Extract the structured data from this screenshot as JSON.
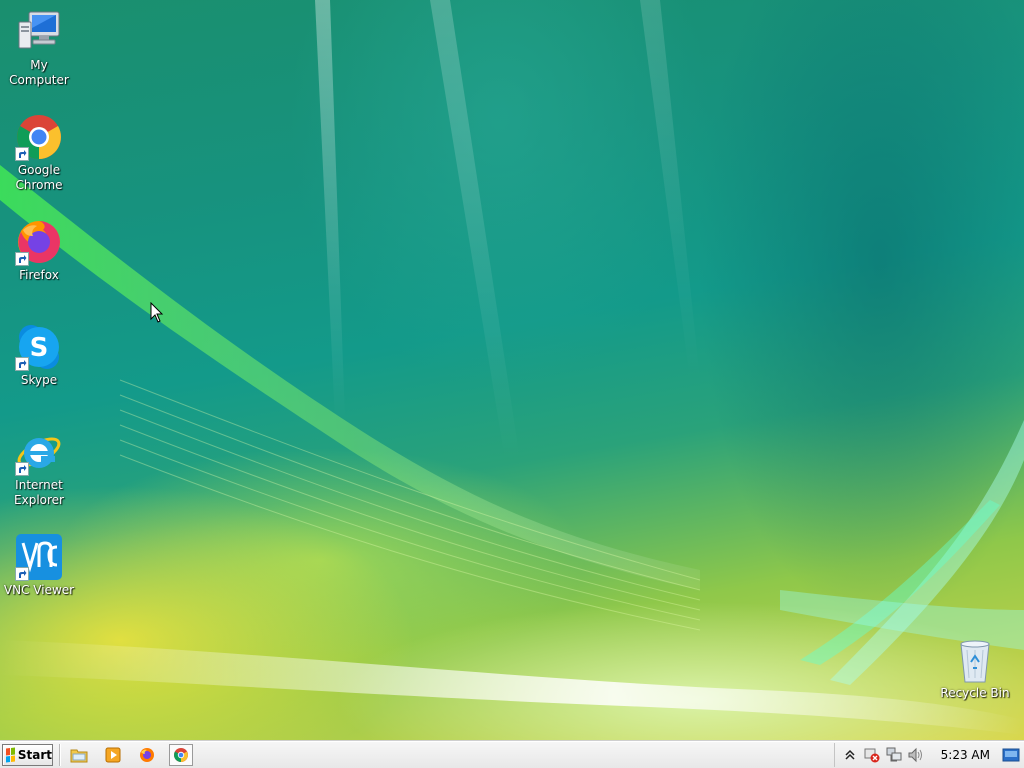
{
  "desktop": {
    "icons": [
      {
        "label": "My Computer",
        "icon": "computer-icon"
      },
      {
        "label": "Google Chrome",
        "icon": "chrome-icon"
      },
      {
        "label": "Firefox",
        "icon": "firefox-icon"
      },
      {
        "label": "Skype",
        "icon": "skype-icon"
      },
      {
        "label": "Internet Explorer",
        "icon": "ie-icon"
      },
      {
        "label": "VNC Viewer",
        "icon": "vnc-icon"
      },
      {
        "label": "Recycle Bin",
        "icon": "recycle-bin-icon"
      }
    ]
  },
  "taskbar": {
    "start_label": "Start",
    "quick_launch": [
      "file-explorer-icon",
      "media-player-icon",
      "firefox-icon",
      "chrome-icon"
    ],
    "tray": [
      "show-hidden-icons-icon",
      "network-error-icon",
      "network-icon",
      "volume-icon"
    ],
    "clock": "5:23 AM",
    "show_desktop": "show-desktop-icon"
  },
  "colors": {
    "taskbar_bg": "#ececec",
    "label_text": "#ffffff"
  }
}
